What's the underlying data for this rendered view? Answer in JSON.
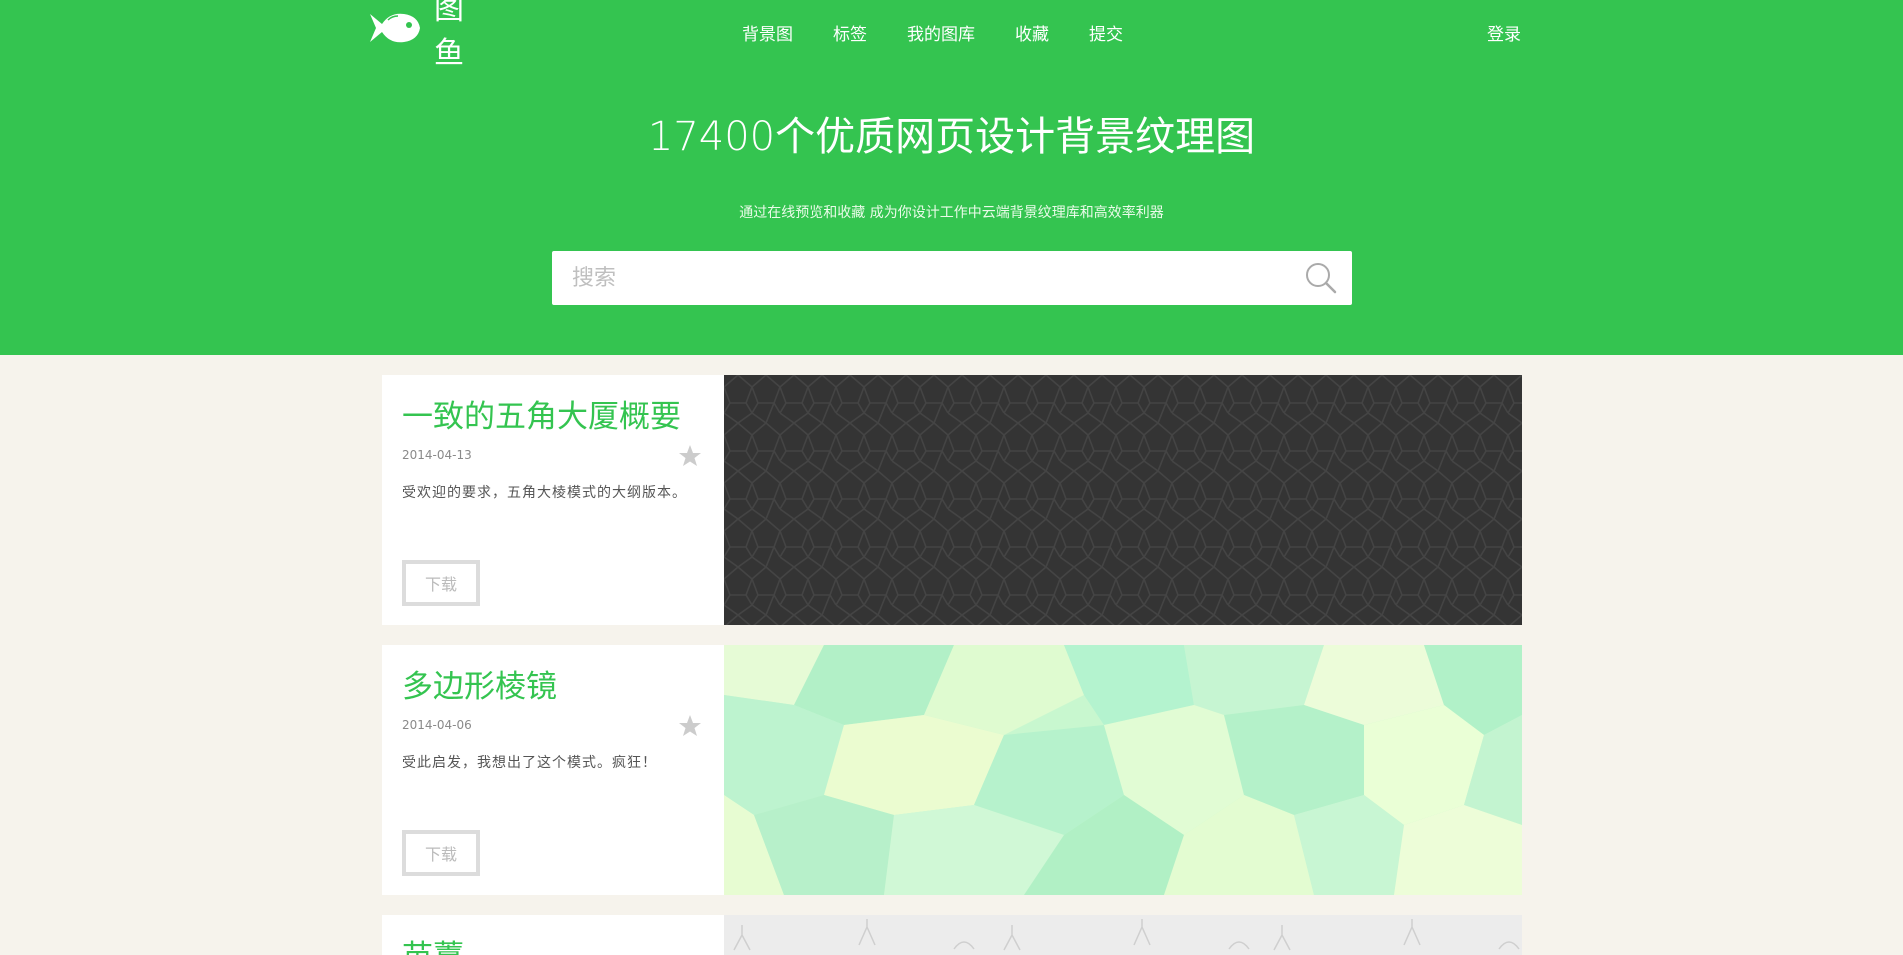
{
  "brand": {
    "name": "图鱼"
  },
  "nav": [
    {
      "label": "背景图"
    },
    {
      "label": "标签"
    },
    {
      "label": "我的图库"
    },
    {
      "label": "收藏"
    },
    {
      "label": "提交"
    }
  ],
  "login_label": "登录",
  "hero": {
    "title": "17400个优质网页设计背景纹理图",
    "subtitle": "通过在线预览和收藏 成为你设计工作中云端背景纹理库和高效率利器"
  },
  "search": {
    "placeholder": "搜索"
  },
  "cards": [
    {
      "title": "一致的五角大厦概要",
      "date": "2014-04-13",
      "description": "受欢迎的要求，五角大棱模式的大纲版本。",
      "download_label": "下载"
    },
    {
      "title": "多边形棱镜",
      "date": "2014-04-06",
      "description": "受此启发，我想出了这个模式。疯狂！",
      "download_label": "下载"
    },
    {
      "title": "苗薹"
    }
  ],
  "colors": {
    "brand_green": "#34c450",
    "page_bg": "#f6f3ec",
    "star_gray": "#cccccc"
  }
}
